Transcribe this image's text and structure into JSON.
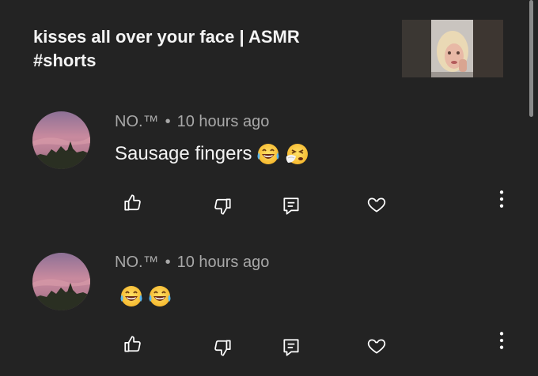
{
  "video": {
    "title": "kisses all over your face | ASMR\n#shorts",
    "thumbnail_icon": "video-thumbnail"
  },
  "comments": [
    {
      "author": "NO.™",
      "separator": "•",
      "time": "10 hours ago",
      "text": "Sausage fingers",
      "emojis": [
        "face-with-tears-of-joy",
        "sneezing-face"
      ]
    },
    {
      "author": "NO.™",
      "separator": "•",
      "time": "10 hours ago",
      "text": "",
      "emojis": [
        "face-with-tears-of-joy",
        "face-with-tears-of-joy"
      ]
    }
  ],
  "actions": {
    "like_icon": "thumbs-up-icon",
    "dislike_icon": "thumbs-down-icon",
    "reply_icon": "reply-comment-icon",
    "heart_icon": "heart-icon",
    "more_icon": "more-vertical-icon"
  },
  "colors": {
    "background": "#232323",
    "meta_text": "#a8a8a8",
    "text": "#f2f2f2"
  }
}
